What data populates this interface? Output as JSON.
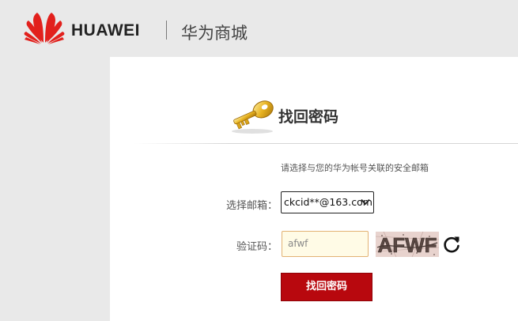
{
  "header": {
    "brand": "HUAWEI",
    "mall_name": "华为商城",
    "logo_icon": "huawei-petal-logo",
    "brand_color": "#e2201c"
  },
  "form": {
    "title": "找回密码",
    "title_icon": "golden-key-icon",
    "hint": "请选择与您的华为帐号关联的安全邮箱",
    "email_label": "选择邮箱：",
    "email_value": "ckcid**@163.com",
    "captcha_label": "验证码：",
    "captcha_value": "afwf",
    "captcha_image_text": "AFWF",
    "refresh_icon": "refresh-icon",
    "submit_label": "找回密码",
    "accent_color": "#b8080e"
  }
}
